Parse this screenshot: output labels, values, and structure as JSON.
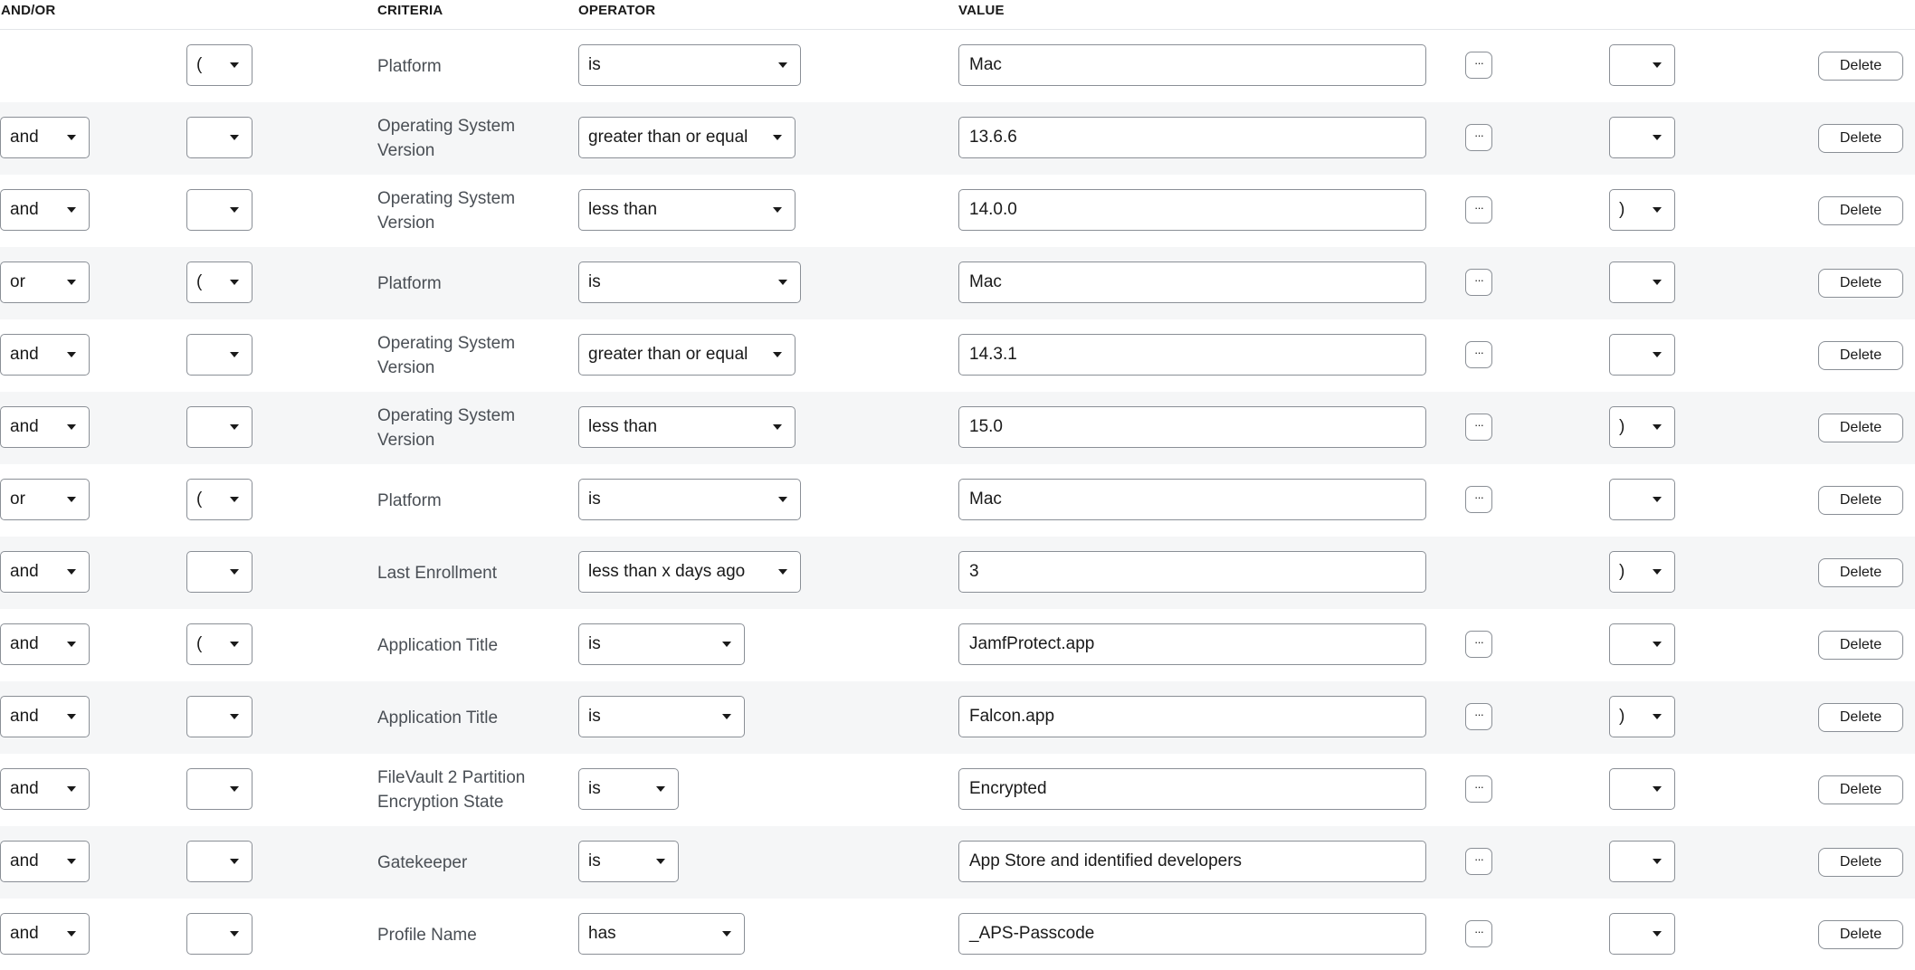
{
  "headers": {
    "andor": "AND/OR",
    "criteria": "CRITERIA",
    "operator": "OPERATOR",
    "value": "VALUE"
  },
  "more_label": "···",
  "delete_label": "Delete",
  "rows": [
    {
      "andor": "",
      "open": "(",
      "criteria": "Platform",
      "operator": "is",
      "value": "Mac",
      "more": true,
      "close": ""
    },
    {
      "andor": "and",
      "open": "",
      "criteria": "Operating System Version",
      "operator": "greater than or equal",
      "value": "13.6.6",
      "more": true,
      "close": ""
    },
    {
      "andor": "and",
      "open": "",
      "criteria": "Operating System Version",
      "operator": "less than",
      "value": "14.0.0",
      "more": true,
      "close": ")"
    },
    {
      "andor": "or",
      "open": "(",
      "criteria": "Platform",
      "operator": "is",
      "value": "Mac",
      "more": true,
      "close": ""
    },
    {
      "andor": "and",
      "open": "",
      "criteria": "Operating System Version",
      "operator": "greater than or equal",
      "value": "14.3.1",
      "more": true,
      "close": ""
    },
    {
      "andor": "and",
      "open": "",
      "criteria": "Operating System Version",
      "operator": "less than",
      "value": "15.0",
      "more": true,
      "close": ")"
    },
    {
      "andor": "or",
      "open": "(",
      "criteria": "Platform",
      "operator": "is",
      "value": "Mac",
      "more": true,
      "close": ""
    },
    {
      "andor": "and",
      "open": "",
      "criteria": "Last Enrollment",
      "operator": "less than x days ago",
      "value": "3",
      "more": false,
      "close": ")"
    },
    {
      "andor": "and",
      "open": "(",
      "criteria": "Application Title",
      "operator": "is",
      "value": "JamfProtect.app",
      "more": true,
      "close": ""
    },
    {
      "andor": "and",
      "open": "",
      "criteria": "Application Title",
      "operator": "is",
      "value": "Falcon.app",
      "more": true,
      "close": ")"
    },
    {
      "andor": "and",
      "open": "",
      "criteria": "FileVault 2 Partition Encryption State",
      "operator": "is",
      "value": "Encrypted",
      "more": true,
      "close": ""
    },
    {
      "andor": "and",
      "open": "",
      "criteria": "Gatekeeper",
      "operator": "is",
      "value": "App Store and identified developers",
      "more": true,
      "close": ""
    },
    {
      "andor": "and",
      "open": "",
      "criteria": "Profile Name",
      "operator": "has",
      "value": "_APS-Passcode",
      "more": true,
      "close": ""
    }
  ]
}
